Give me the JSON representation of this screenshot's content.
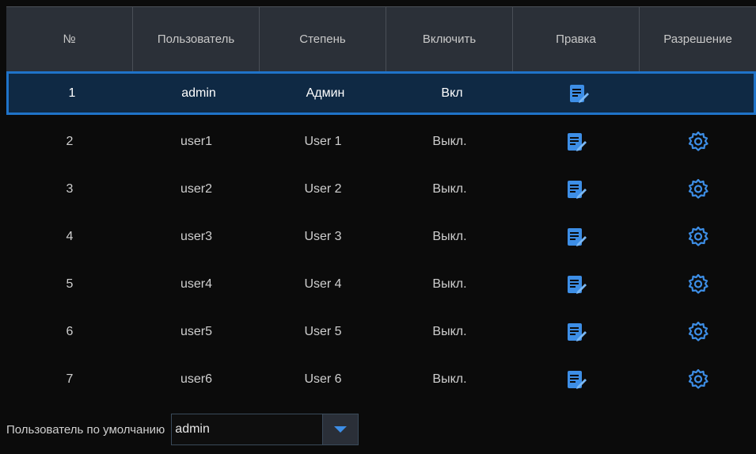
{
  "headers": [
    "№",
    "Пользователь",
    "Степень",
    "Включить",
    "Правка",
    "Разрешение"
  ],
  "rows": [
    {
      "num": "1",
      "user": "admin",
      "level": "Админ",
      "enabled": "Вкл",
      "has_edit": true,
      "has_permission": false,
      "selected": true
    },
    {
      "num": "2",
      "user": "user1",
      "level": "User 1",
      "enabled": "Выкл.",
      "has_edit": true,
      "has_permission": true,
      "selected": false
    },
    {
      "num": "3",
      "user": "user2",
      "level": "User 2",
      "enabled": "Выкл.",
      "has_edit": true,
      "has_permission": true,
      "selected": false
    },
    {
      "num": "4",
      "user": "user3",
      "level": "User 3",
      "enabled": "Выкл.",
      "has_edit": true,
      "has_permission": true,
      "selected": false
    },
    {
      "num": "5",
      "user": "user4",
      "level": "User 4",
      "enabled": "Выкл.",
      "has_edit": true,
      "has_permission": true,
      "selected": false
    },
    {
      "num": "6",
      "user": "user5",
      "level": "User 5",
      "enabled": "Выкл.",
      "has_edit": true,
      "has_permission": true,
      "selected": false
    },
    {
      "num": "7",
      "user": "user6",
      "level": "User 6",
      "enabled": "Выкл.",
      "has_edit": true,
      "has_permission": true,
      "selected": false
    }
  ],
  "footer": {
    "label": "Пользователь по умолчанию",
    "select_value": "admin"
  },
  "icons": {
    "edit": "edit-icon",
    "permission": "gear-icon",
    "dropdown": "chevron-down-icon"
  },
  "colors": {
    "accent": "#1f73c9",
    "header_bg": "#2b3038",
    "selected_bg": "#0f2944",
    "icon_blue": "#3d8ee6"
  }
}
